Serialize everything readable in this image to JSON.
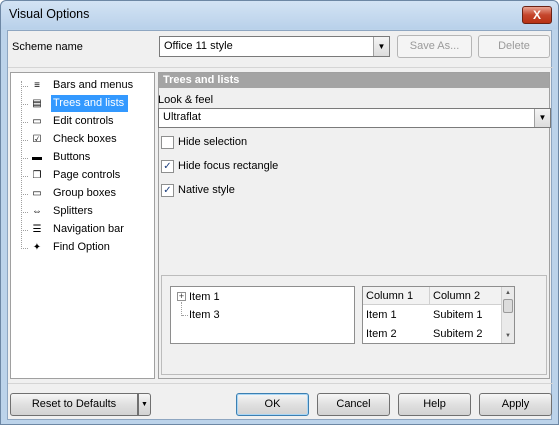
{
  "window": {
    "title": "Visual Options",
    "close_glyph": "X"
  },
  "scheme": {
    "label": "Scheme name",
    "value": "Office 11 style",
    "save_as": "Save As...",
    "delete": "Delete"
  },
  "nav": {
    "items": [
      {
        "label": "Bars and menus",
        "icon": "bars-menus-icon",
        "glyph": "≡"
      },
      {
        "label": "Trees and lists",
        "icon": "tree-icon",
        "glyph": "▤"
      },
      {
        "label": "Edit controls",
        "icon": "edit-icon",
        "glyph": "▭"
      },
      {
        "label": "Check boxes",
        "icon": "checkbox-icon",
        "glyph": "☑"
      },
      {
        "label": "Buttons",
        "icon": "button-icon",
        "glyph": "▬"
      },
      {
        "label": "Page controls",
        "icon": "folder-tab-icon",
        "glyph": "❐"
      },
      {
        "label": "Group boxes",
        "icon": "group-box-icon",
        "glyph": "▭"
      },
      {
        "label": "Splitters",
        "icon": "splitter-icon",
        "glyph": "⇔"
      },
      {
        "label": "Navigation bar",
        "icon": "navigation-bar-icon",
        "glyph": "☰"
      },
      {
        "label": "Find Option",
        "icon": "find-option-icon",
        "glyph": "✦"
      }
    ],
    "selected_index": 1
  },
  "panel": {
    "header": "Trees and lists",
    "look_label": "Look & feel",
    "look_value": "Ultraflat",
    "options": [
      {
        "label": "Hide selection",
        "checked": false
      },
      {
        "label": "Hide focus rectangle",
        "checked": true
      },
      {
        "label": "Native style",
        "checked": true
      }
    ],
    "preview": {
      "tree_items": [
        "Item 1",
        "Item 3"
      ],
      "expand_glyph": "+",
      "list_columns": [
        "Column 1",
        "Column 2"
      ],
      "list_rows": [
        [
          "Item 1",
          "Subitem 1"
        ],
        [
          "Item 2",
          "Subitem 2"
        ]
      ]
    }
  },
  "footer": {
    "reset": "Reset to Defaults",
    "ok": "OK",
    "cancel": "Cancel",
    "help": "Help",
    "apply": "Apply"
  },
  "colors": {
    "selection": "#3399ff",
    "header_bg": "#a4a4a4",
    "title_bg": "#bcd3ea"
  }
}
